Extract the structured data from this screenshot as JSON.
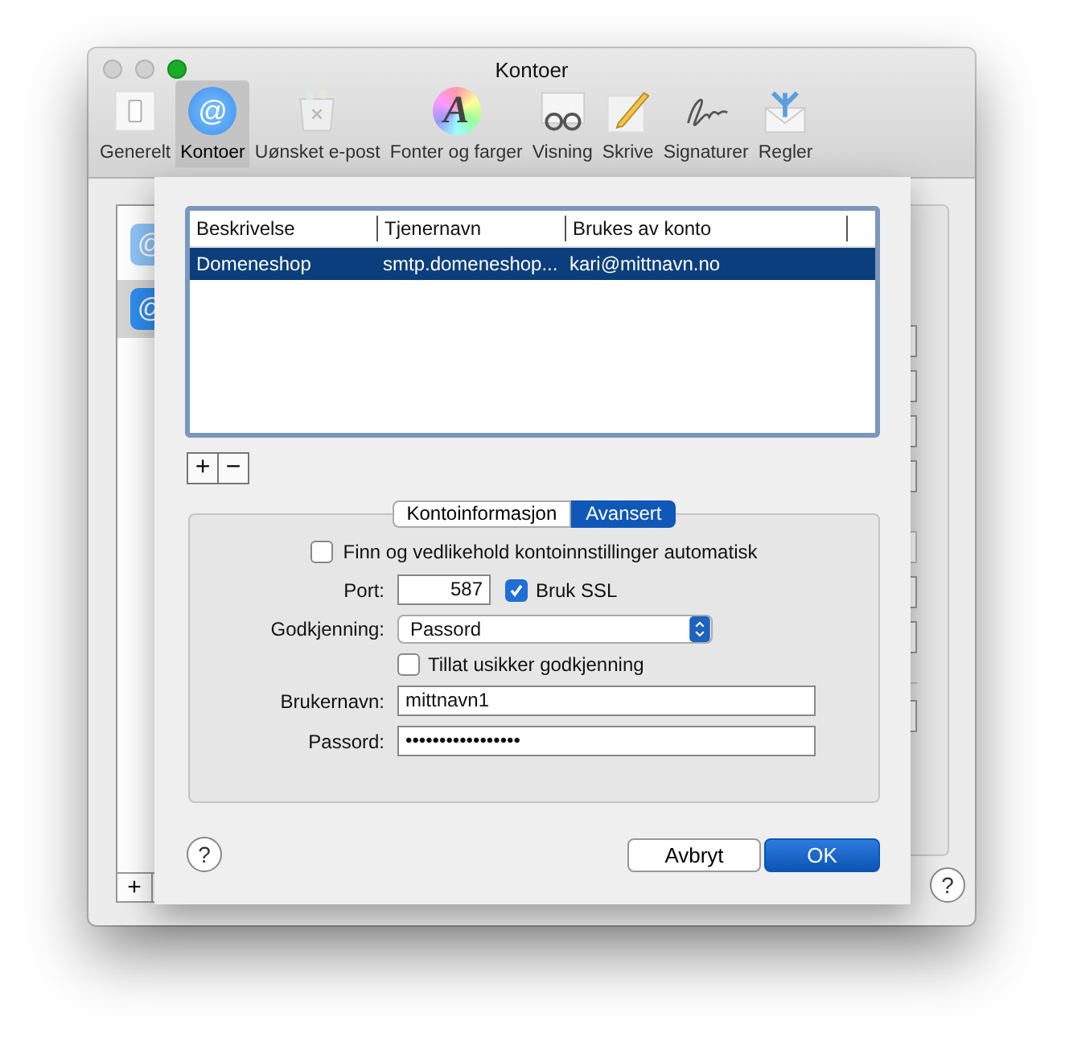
{
  "window": {
    "title": "Kontoer"
  },
  "toolbar": [
    {
      "label": "Generelt",
      "kind": "switch",
      "selected": false
    },
    {
      "label": "Kontoer",
      "kind": "at",
      "glyph": "@",
      "selected": true
    },
    {
      "label": "Uønsket e-post",
      "kind": "trash",
      "selected": false
    },
    {
      "label": "Fonter og farger",
      "kind": "font",
      "glyph": "A",
      "selected": false
    },
    {
      "label": "Visning",
      "kind": "glasses",
      "selected": false
    },
    {
      "label": "Skrive",
      "kind": "pencil",
      "selected": false
    },
    {
      "label": "Signaturer",
      "kind": "signature",
      "selected": false
    },
    {
      "label": "Regler",
      "kind": "rules",
      "selected": false
    }
  ],
  "accounts": [
    {
      "glyph": "@",
      "selected": false
    },
    {
      "glyph": "@",
      "selected": true
    }
  ],
  "accounts_add": "+",
  "help": "?",
  "sheet": {
    "table": {
      "columns": [
        "Beskrivelse",
        "Tjenernavn",
        "Brukes av konto"
      ],
      "rows": [
        {
          "cells": [
            "Domeneshop",
            "smtp.domeneshop...",
            "kari@mittnavn.no"
          ],
          "selected": true
        }
      ]
    },
    "add_button": "+",
    "remove_button": "−",
    "tabs": [
      {
        "label": "Kontoinformasjon",
        "selected": false
      },
      {
        "label": "Avansert",
        "selected": true
      }
    ],
    "auto_settings": {
      "label": "Finn og vedlikehold kontoinnstillinger automatisk",
      "checked": false
    },
    "port": {
      "label": "Port:",
      "value": "587"
    },
    "ssl": {
      "label": "Bruk SSL",
      "checked": true
    },
    "authentication": {
      "label": "Godkjenning:",
      "value": "Passord"
    },
    "insecure_auth": {
      "label": "Tillat usikker godkjenning",
      "checked": false
    },
    "username": {
      "label": "Brukernavn:",
      "value": "mittnavn1"
    },
    "password": {
      "label": "Passord:",
      "value": "•••••••••••••••••"
    },
    "help": "?",
    "buttons": [
      {
        "label": "Avbryt",
        "kind": "default"
      },
      {
        "label": "OK",
        "kind": "primary"
      }
    ]
  }
}
